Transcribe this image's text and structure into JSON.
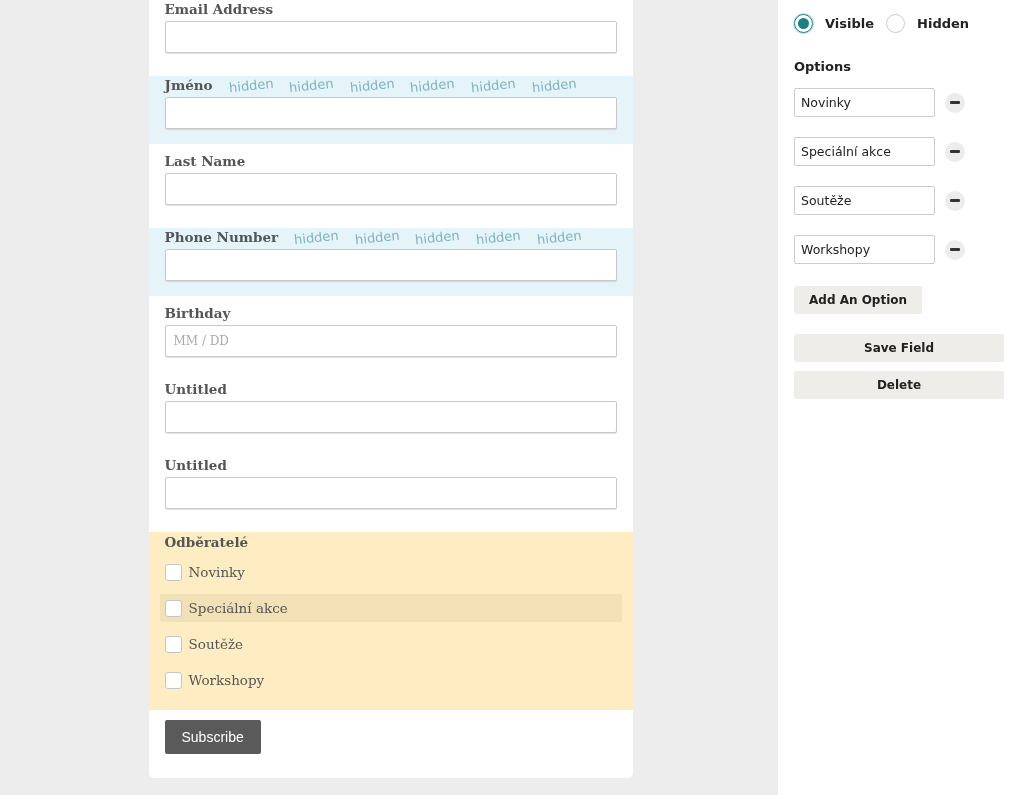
{
  "form": {
    "fields": [
      {
        "kind": "text",
        "label": "Email Address",
        "hidden": false
      },
      {
        "kind": "text",
        "label": "Jméno",
        "hidden": true,
        "watermarks": [
          "hidden",
          "hidden",
          "hidden",
          "hidden",
          "hidden",
          "hidden"
        ]
      },
      {
        "kind": "text",
        "label": "Last Name",
        "hidden": false
      },
      {
        "kind": "text",
        "label": "Phone Number",
        "hidden": true,
        "watermarks": [
          "hidden",
          "hidden",
          "hidden",
          "hidden",
          "hidden"
        ]
      },
      {
        "kind": "date",
        "label": "Birthday",
        "placeholder": "MM / DD",
        "hidden": false
      },
      {
        "kind": "text",
        "label": "Untitled",
        "hidden": false
      },
      {
        "kind": "text",
        "label": "Untitled",
        "hidden": false
      }
    ],
    "checkbox_group": {
      "label": "Odběratelé",
      "options": [
        {
          "label": "Novinky",
          "checked": false,
          "highlighted": false
        },
        {
          "label": "Speciální akce",
          "checked": false,
          "highlighted": true
        },
        {
          "label": "Soutěže",
          "checked": false,
          "highlighted": false
        },
        {
          "label": "Workshopy",
          "checked": false,
          "highlighted": false
        }
      ]
    },
    "submit": "Subscribe"
  },
  "panel": {
    "visibility": [
      {
        "label": "Visible",
        "selected": true
      },
      {
        "label": "Hidden",
        "selected": false
      }
    ],
    "options_title": "Options",
    "options": [
      {
        "value": "Novinky"
      },
      {
        "value": "Speciální akce"
      },
      {
        "value": "Soutěže"
      },
      {
        "value": "Workshopy"
      }
    ],
    "add_option": "Add An Option",
    "save": "Save Field",
    "delete": "Delete"
  }
}
